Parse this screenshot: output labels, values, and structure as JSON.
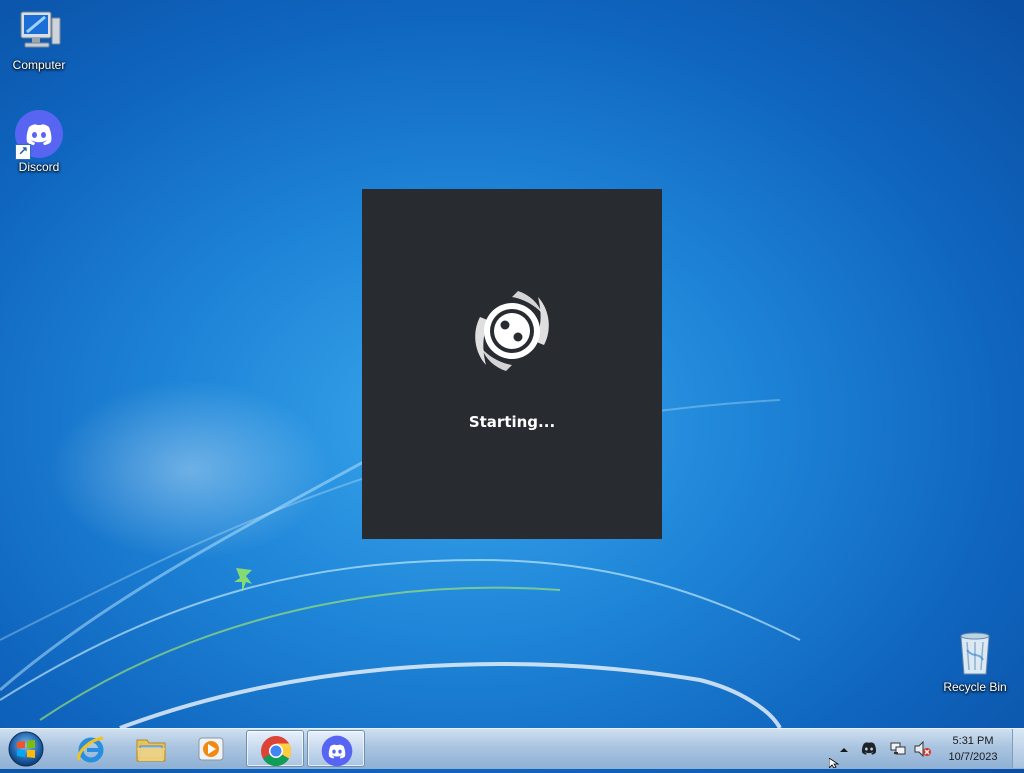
{
  "desktop": {
    "icons": [
      {
        "label": "Computer"
      },
      {
        "label": "Discord"
      },
      {
        "label": "Recycle Bin"
      }
    ]
  },
  "splash": {
    "status_text": "Starting..."
  },
  "taskbar": {
    "pinned": [
      "internet-explorer",
      "windows-explorer",
      "media-player",
      "chrome",
      "discord"
    ],
    "clock": {
      "time": "5:31 PM",
      "date": "10/7/2023"
    }
  },
  "colors": {
    "splash_bg": "#282b30",
    "discord_blurple": "#5865f2"
  }
}
